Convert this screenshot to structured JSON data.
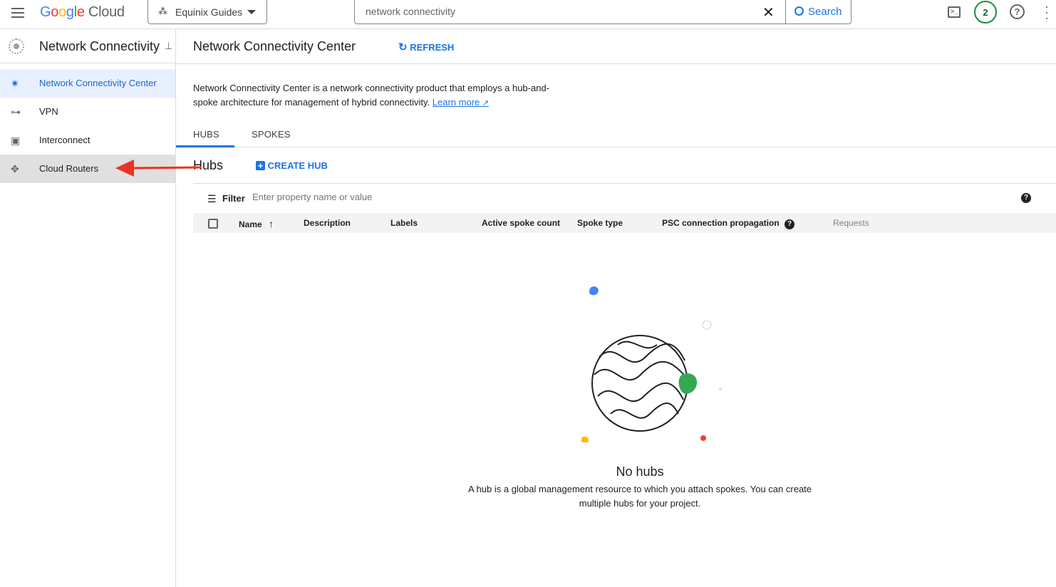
{
  "topbar": {
    "logo": "Google Cloud",
    "project": "Equinix Guides",
    "search_value": "network connectivity",
    "search_button": "Search",
    "notifications_count": "2"
  },
  "sidebar": {
    "title": "Network Connectivity",
    "items": [
      {
        "label": "Network Connectivity Center",
        "icon": "hub-icon",
        "active": true
      },
      {
        "label": "VPN",
        "icon": "vpn-icon"
      },
      {
        "label": "Interconnect",
        "icon": "interconnect-icon"
      },
      {
        "label": "Cloud Routers",
        "icon": "router-icon",
        "hovered": true
      }
    ]
  },
  "main": {
    "title": "Network Connectivity Center",
    "refresh": "REFRESH",
    "description": "Network Connectivity Center is a network connectivity product that employs a hub-and-spoke architecture for management of hybrid connectivity.",
    "learn_more": "Learn more",
    "tabs": [
      {
        "label": "HUBS",
        "active": true
      },
      {
        "label": "SPOKES"
      }
    ],
    "section_title": "Hubs",
    "create_hub": "CREATE HUB",
    "filter_label": "Filter",
    "filter_placeholder": "Enter property name or value",
    "columns": [
      "Name",
      "Description",
      "Labels",
      "Active spoke count",
      "Spoke type",
      "PSC connection propagation",
      "Requests"
    ],
    "empty_title": "No hubs",
    "empty_text": "A hub is a global management resource to which you attach spokes. You can create multiple hubs for your project."
  },
  "colors": {
    "accent": "#1a73e8",
    "arrow": "#ea3323"
  }
}
